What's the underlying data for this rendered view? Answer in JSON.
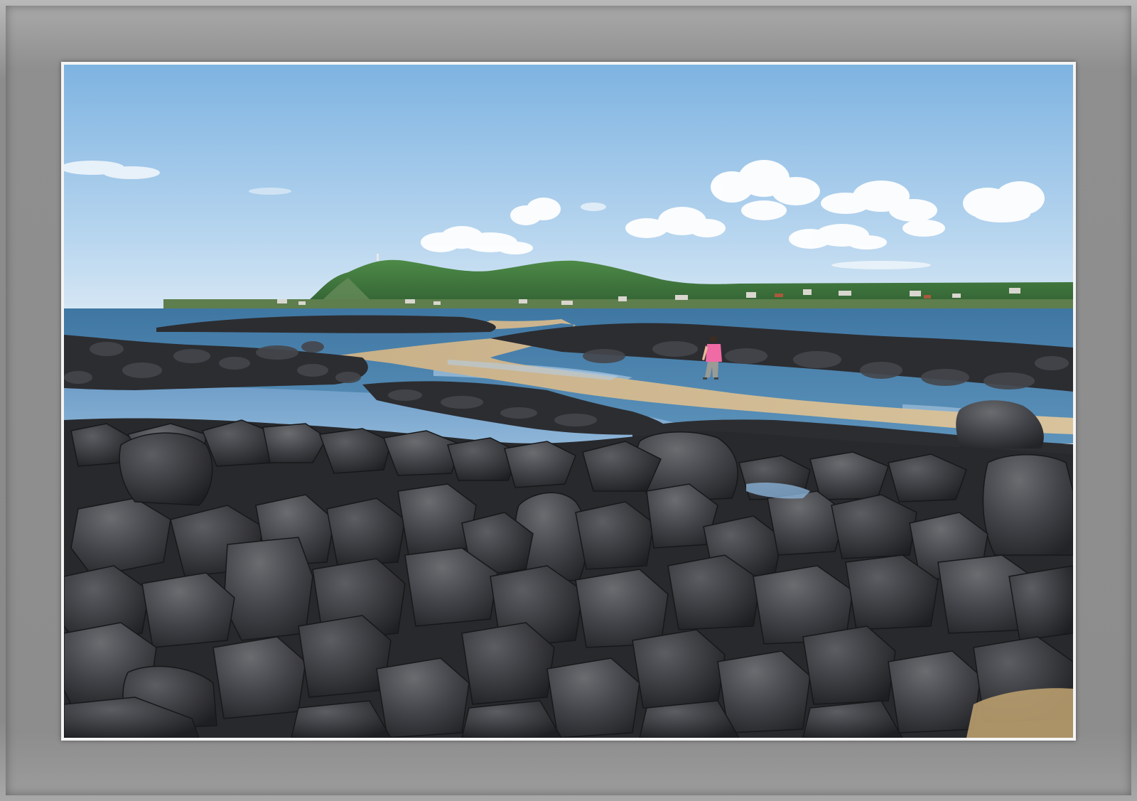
{
  "image": {
    "subject": "rocky-coastline-with-person-on-causeway",
    "colors": {
      "sky_top": "#7fb3e0",
      "sky_bottom": "#c9e0f2",
      "sea": "#4f86ad",
      "rock": "#2e2f33",
      "path": "#c7b186",
      "hill": "#3f7a3a",
      "shirt": "#f06aa5"
    }
  }
}
